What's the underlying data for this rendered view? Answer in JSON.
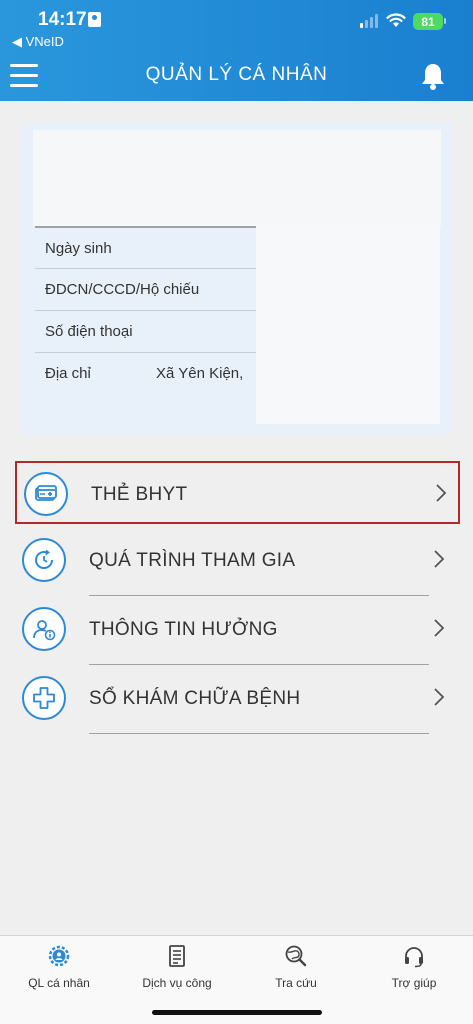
{
  "status_bar": {
    "time": "14:17",
    "back_label": "◀ VNeID",
    "battery": "81"
  },
  "header": {
    "title": "QUẢN LÝ CÁ NHÂN"
  },
  "profile": {
    "rows": [
      {
        "label": "Ngày sinh",
        "value": ""
      },
      {
        "label": "ĐDCN/CCCD/Hộ chiếu",
        "value": ""
      },
      {
        "label": "Số điện thoại",
        "value": ""
      },
      {
        "label": "Địa chỉ",
        "value": "Xã Yên Kiện,"
      }
    ]
  },
  "menu": {
    "items": [
      {
        "label": "THẺ BHYT",
        "icon": "health-card-icon"
      },
      {
        "label": "QUÁ TRÌNH THAM GIA",
        "icon": "history-icon"
      },
      {
        "label": "THÔNG TIN HƯỞNG",
        "icon": "user-info-icon"
      },
      {
        "label": "SỔ KHÁM CHỮA BỆNH",
        "icon": "medical-cross-icon"
      }
    ]
  },
  "tabbar": {
    "tabs": [
      {
        "label": "QL cá nhân",
        "icon": "personal-gear-icon"
      },
      {
        "label": "Dịch vụ công",
        "icon": "document-icon"
      },
      {
        "label": "Tra cứu",
        "icon": "search-globe-icon"
      },
      {
        "label": "Trợ giúp",
        "icon": "headset-icon"
      }
    ]
  },
  "colors": {
    "header_start": "#2a97dc",
    "header_end": "#1a7fd0",
    "accent": "#2d89d6",
    "highlight_border": "#b02a2a",
    "background": "#efefef"
  }
}
